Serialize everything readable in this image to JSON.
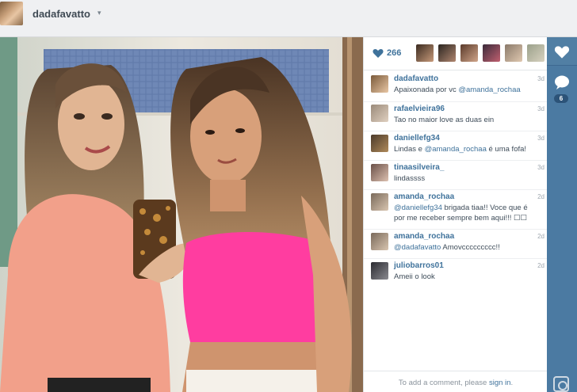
{
  "header": {
    "username": "dadafavatto",
    "caret": "▾"
  },
  "likes": {
    "count": "266"
  },
  "comments": [
    {
      "user": "dadafavatto",
      "time": "3d",
      "text": "Apaixonada por vc ",
      "mention": "@amanda_rochaa",
      "text_after": ""
    },
    {
      "user": "rafaelvieira96",
      "time": "3d",
      "text": "Tao no maior love as duas ein",
      "mention": "",
      "text_after": ""
    },
    {
      "user": "daniellefg34",
      "time": "3d",
      "text": "Lindas e ",
      "mention": "@amanda_rochaa",
      "text_after": " é uma fofa!"
    },
    {
      "user": "tinaasilveira_",
      "time": "3d",
      "text": "lindassss",
      "mention": "",
      "text_after": ""
    },
    {
      "user": "amanda_rochaa",
      "time": "2d",
      "text": "",
      "mention": "@daniellefg34",
      "text_after": " brigada tiaa!! Voce que é por me receber sempre bem aqui!!! ☐☐"
    },
    {
      "user": "amanda_rochaa",
      "time": "2d",
      "text": "",
      "mention": "@dadafavatto",
      "text_after": " Amovccccccccc!!"
    },
    {
      "user": "juliobarros01",
      "time": "2d",
      "text": "Ameii o look",
      "mention": "",
      "text_after": ""
    }
  ],
  "add_comment": {
    "prefix": "To add a comment, please ",
    "link": "sign in",
    "suffix": "."
  },
  "actions": {
    "comment_count": "6"
  },
  "colors": {
    "link": "#3f729b",
    "action_bar": "#4b7aa2",
    "header_bg": "#eff0f2"
  }
}
